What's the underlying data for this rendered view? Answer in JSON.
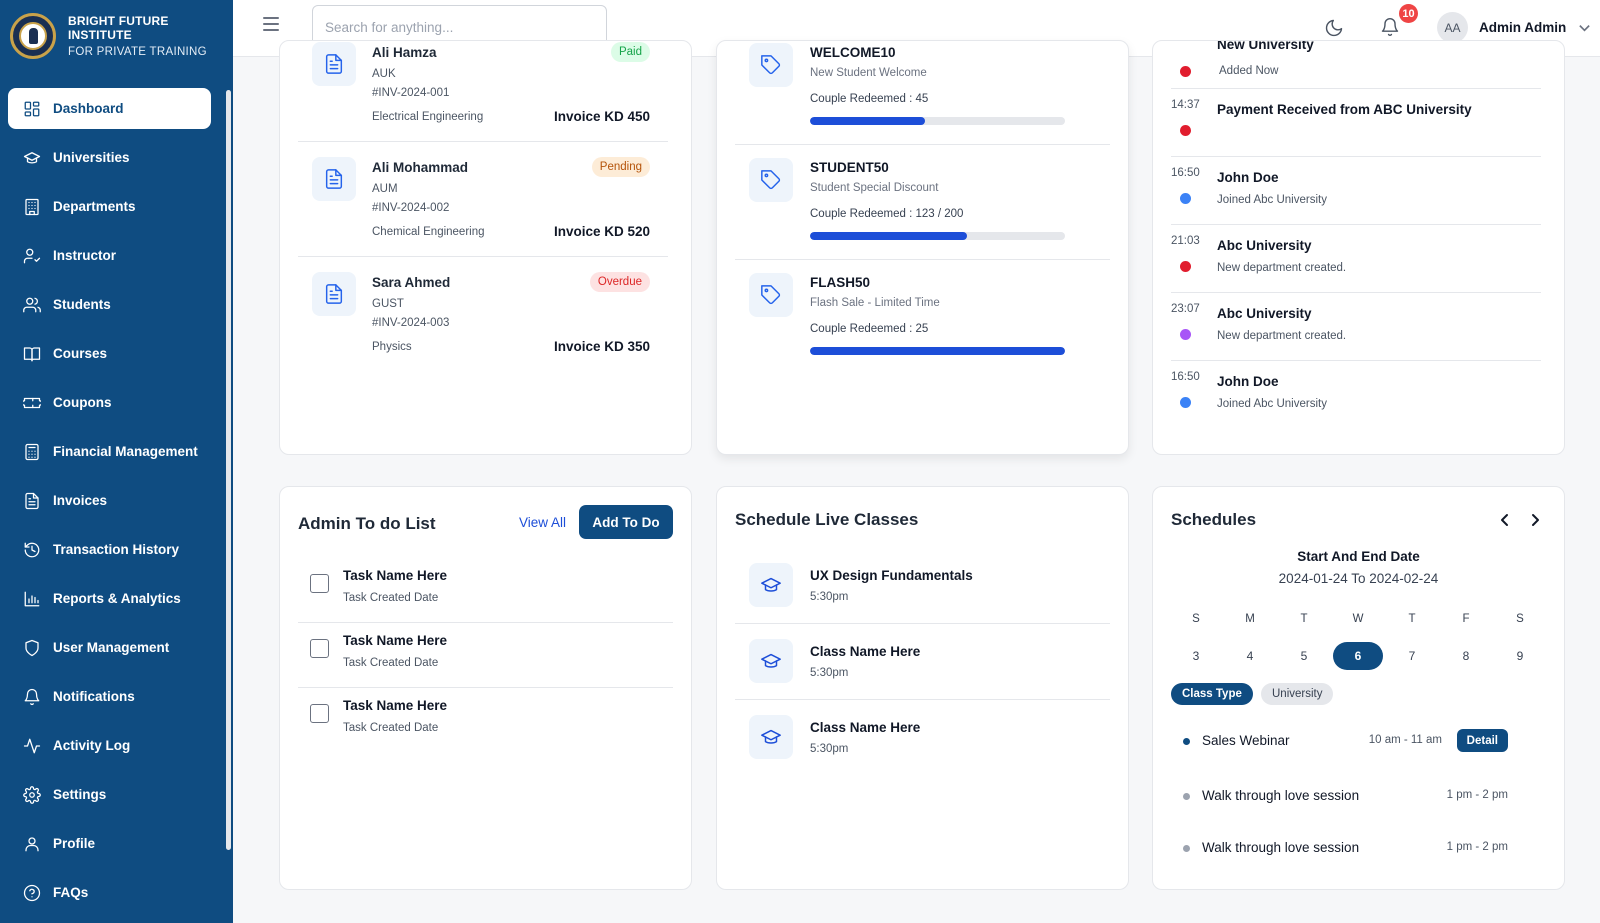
{
  "brand": {
    "name": "BRIGHT FUTURE INSTITUTE",
    "subtitle": "FOR PRIVATE TRAINING"
  },
  "sidebar": {
    "items": [
      {
        "label": "Dashboard",
        "icon": "dashboard-icon",
        "active": true
      },
      {
        "label": "Universities",
        "icon": "graduation-cap-icon"
      },
      {
        "label": "Departments",
        "icon": "building-icon"
      },
      {
        "label": "Instructor",
        "icon": "user-check-icon"
      },
      {
        "label": "Students",
        "icon": "users-icon"
      },
      {
        "label": "Courses",
        "icon": "book-icon"
      },
      {
        "label": "Coupons",
        "icon": "ticket-icon"
      },
      {
        "label": "Financial Management",
        "icon": "calculator-icon"
      },
      {
        "label": "Invoices",
        "icon": "file-icon"
      },
      {
        "label": "Transaction History",
        "icon": "history-icon"
      },
      {
        "label": "Reports & Analytics",
        "icon": "bar-chart-icon"
      },
      {
        "label": "User Management",
        "icon": "shield-icon"
      },
      {
        "label": "Notifications",
        "icon": "bell-icon"
      },
      {
        "label": "Activity Log",
        "icon": "activity-icon"
      },
      {
        "label": "Settings",
        "icon": "gear-icon"
      },
      {
        "label": "Profile",
        "icon": "user-icon"
      },
      {
        "label": "FAQs",
        "icon": "help-circle-icon"
      }
    ]
  },
  "topbar": {
    "search_placeholder": "Search for anything...",
    "notification_count": "10",
    "user_initials": "AA",
    "user_name": "Admin Admin"
  },
  "invoices": {
    "rows": [
      {
        "name": "Ali Hamza",
        "university": "AUK",
        "id": "#INV-2024-001",
        "department": "Electrical Engineering",
        "amount": "Invoice KD 450",
        "status": "Paid"
      },
      {
        "name": "Ali Mohammad",
        "university": "AUM",
        "id": "#INV-2024-002",
        "department": "Chemical Engineering",
        "amount": "Invoice KD 520",
        "status": "Pending"
      },
      {
        "name": "Sara Ahmed",
        "university": "GUST",
        "id": "#INV-2024-003",
        "department": "Physics",
        "amount": "Invoice KD 350",
        "status": "Overdue"
      }
    ]
  },
  "coupons": {
    "rows": [
      {
        "code": "WELCOME10",
        "description": "New Student Welcome",
        "redeemed": "Couple Redeemed : 45",
        "progress": 0.45
      },
      {
        "code": "STUDENT50",
        "description": "Student Special Discount",
        "redeemed": "Couple Redeemed : 123 / 200",
        "progress": 0.615
      },
      {
        "code": "FLASH50",
        "description": "Flash Sale - Limited Time",
        "redeemed": "Couple Redeemed : 25",
        "progress": 1.0
      }
    ]
  },
  "activity": {
    "rows": [
      {
        "time": "",
        "title": "New University",
        "subtitle": "Added Now",
        "dot": "#e11d2e"
      },
      {
        "time": "14:37",
        "title": "Payment Received from ABC University",
        "subtitle": "",
        "dot": "#e11d2e"
      },
      {
        "time": "16:50",
        "title": "John Doe",
        "subtitle": "Joined Abc University",
        "dot": "#3b82f6"
      },
      {
        "time": "21:03",
        "title": "Abc University",
        "subtitle": "New department created.",
        "dot": "#e11d2e"
      },
      {
        "time": "23:07",
        "title": "Abc University",
        "subtitle": "New department created.",
        "dot": "#a855f7"
      },
      {
        "time": "16:50",
        "title": "John Doe",
        "subtitle": "Joined Abc University",
        "dot": "#3b82f6"
      }
    ]
  },
  "todo": {
    "title": "Admin To do List",
    "view_all": "View All",
    "add_button": "Add To Do",
    "items": [
      {
        "name": "Task Name Here",
        "date": "Task Created Date"
      },
      {
        "name": "Task Name Here",
        "date": "Task Created Date"
      },
      {
        "name": "Task Name Here",
        "date": "Task Created Date"
      }
    ]
  },
  "live_classes": {
    "title": "Schedule Live Classes",
    "items": [
      {
        "name": "UX Design Fundamentals",
        "time": "5:30pm"
      },
      {
        "name": "Class Name Here",
        "time": "5:30pm"
      },
      {
        "name": "Class Name Here",
        "time": "5:30pm"
      }
    ]
  },
  "schedules": {
    "title": "Schedules",
    "range_label": "Start And End Date",
    "range_value": "2024-01-24 To 2024-02-24",
    "weekdays": [
      "S",
      "M",
      "T",
      "W",
      "T",
      "F",
      "S"
    ],
    "days": [
      "3",
      "4",
      "5",
      "6",
      "7",
      "8",
      "9"
    ],
    "selected_day": "6",
    "filters": [
      {
        "label": "Class Type",
        "active": true
      },
      {
        "label": "University",
        "active": false
      }
    ],
    "events": [
      {
        "name": "Sales Webinar",
        "time": "10 am - 11 am",
        "action": "Detail",
        "dot": "#0f4c81"
      },
      {
        "name": "Walk through love session",
        "time": "1 pm - 2 pm",
        "action": "",
        "dot": "#9ca3af"
      },
      {
        "name": "Walk through love session",
        "time": "1 pm - 2 pm",
        "action": "",
        "dot": "#9ca3af"
      }
    ]
  },
  "colors": {
    "primary": "#0f4c81",
    "accent": "#1d4ed8",
    "danger": "#ef4444"
  }
}
